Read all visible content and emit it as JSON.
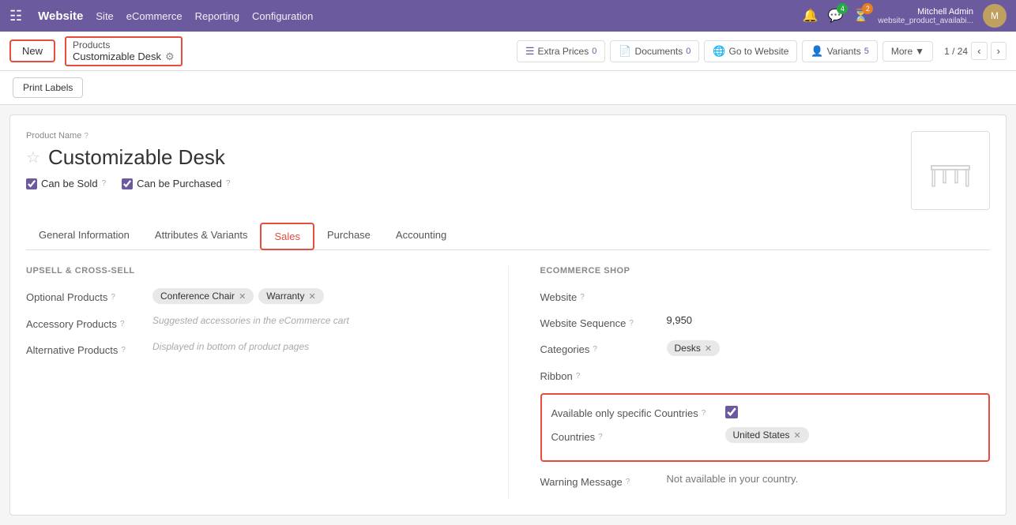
{
  "topnav": {
    "brand": "Website",
    "items": [
      "Site",
      "eCommerce",
      "Reporting",
      "Configuration"
    ],
    "notifications_count": "4",
    "messages_count": "2",
    "user_name": "Mitchell Admin",
    "user_subtitle": "website_product_availabi...",
    "pagination": "1 / 24"
  },
  "breadcrumb": {
    "parent": "Products",
    "current": "Customizable Desk"
  },
  "buttons": {
    "new_label": "New",
    "print_labels": "Print Labels",
    "extra_prices": "Extra Prices",
    "extra_prices_count": "0",
    "documents": "Documents",
    "documents_count": "0",
    "go_to_website": "Go to Website",
    "variants": "Variants",
    "variants_count": "5",
    "more": "More"
  },
  "product": {
    "name_label": "Product Name",
    "name": "Customizable Desk",
    "can_be_sold": "Can be Sold",
    "can_be_purchased": "Can be Purchased"
  },
  "tabs": [
    {
      "id": "general",
      "label": "General Information"
    },
    {
      "id": "attributes",
      "label": "Attributes & Variants"
    },
    {
      "id": "sales",
      "label": "Sales",
      "active": true
    },
    {
      "id": "purchase",
      "label": "Purchase"
    },
    {
      "id": "accounting",
      "label": "Accounting"
    }
  ],
  "upsell_section": {
    "title": "UPSELL & CROSS-SELL",
    "fields": [
      {
        "label": "Optional Products",
        "tags": [
          "Conference Chair",
          "Warranty"
        ],
        "help": true
      },
      {
        "label": "Accessory Products",
        "placeholder": "Suggested accessories in the eCommerce cart",
        "help": true
      },
      {
        "label": "Alternative Products",
        "placeholder": "Displayed in bottom of product pages",
        "help": true
      }
    ]
  },
  "ecommerce_section": {
    "title": "ECOMMERCE SHOP",
    "fields": [
      {
        "label": "Website",
        "value": "",
        "help": true
      },
      {
        "label": "Website Sequence",
        "value": "9,950",
        "help": true
      },
      {
        "label": "Categories",
        "tags": [
          "Desks"
        ],
        "help": true
      },
      {
        "label": "Ribbon",
        "value": "",
        "help": true
      },
      {
        "label": "Available only specific Countries",
        "checked": true,
        "help": true
      },
      {
        "label": "Countries",
        "tags": [
          "United States"
        ],
        "help": true
      },
      {
        "label": "Warning Message",
        "value": "Not available in your country.",
        "help": true
      }
    ]
  }
}
